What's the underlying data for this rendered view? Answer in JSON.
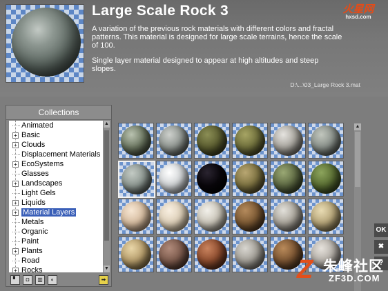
{
  "material": {
    "title": "Large Scale Rock 3",
    "description_1": "A variation of the previous rock materials with different colors and fractal patterns. This material is designed for large scale terrains, hence the scale of 100.",
    "description_2": "Single layer material designed to appear at high altitudes and steep slopes.",
    "file_path": "D:\\...\\03_Large Rock 3.mat",
    "preview_icon": "rock-sphere-preview"
  },
  "watermarks": {
    "top_right_brand": "火星网",
    "top_right_domain": "hxsd.com",
    "bottom_right_logo": "Z",
    "bottom_right_cn": "朱峰社区",
    "bottom_right_en": "ZF3D.COM"
  },
  "collections": {
    "title": "Collections",
    "items": [
      {
        "label": "Animated",
        "expandable": false,
        "selected": false
      },
      {
        "label": "Basic",
        "expandable": true,
        "selected": false
      },
      {
        "label": "Clouds",
        "expandable": true,
        "selected": false
      },
      {
        "label": "Displacement Materials",
        "expandable": false,
        "selected": false
      },
      {
        "label": "EcoSystems",
        "expandable": true,
        "selected": false
      },
      {
        "label": "Glasses",
        "expandable": false,
        "selected": false
      },
      {
        "label": "Landscapes",
        "expandable": true,
        "selected": false
      },
      {
        "label": "Light Gels",
        "expandable": false,
        "selected": false
      },
      {
        "label": "Liquids",
        "expandable": true,
        "selected": false
      },
      {
        "label": "Material Layers",
        "expandable": true,
        "selected": true
      },
      {
        "label": "Metals",
        "expandable": false,
        "selected": false
      },
      {
        "label": "Organic",
        "expandable": false,
        "selected": false
      },
      {
        "label": "Paint",
        "expandable": false,
        "selected": false
      },
      {
        "label": "Plants",
        "expandable": true,
        "selected": false
      },
      {
        "label": "Road",
        "expandable": false,
        "selected": false
      },
      {
        "label": "Rocks",
        "expandable": true,
        "selected": false
      }
    ],
    "toolbar_icons": [
      "new-collection-icon",
      "lock-icon",
      "delete-icon",
      "refresh-icon",
      "go-arrow-icon"
    ],
    "expander_glyph": "+"
  },
  "swatch_grid": {
    "selected_index": 6,
    "swatches": [
      {
        "icon": "mossy-rock-sphere",
        "colors": [
          "#b9c2b0",
          "#6d7862",
          "#2c3326"
        ]
      },
      {
        "icon": "grey-rock-sphere",
        "colors": [
          "#cdd0cc",
          "#8f9590",
          "#3a3f3c"
        ]
      },
      {
        "icon": "green-moss-sphere",
        "colors": [
          "#8b8e55",
          "#5b5d30",
          "#262713"
        ]
      },
      {
        "icon": "olive-sphere",
        "colors": [
          "#a6a464",
          "#70703c",
          "#30301a"
        ]
      },
      {
        "icon": "granite-sphere",
        "colors": [
          "#e5e3df",
          "#a8a59e",
          "#54524d"
        ]
      },
      {
        "icon": "weathered-rock-sphere",
        "colors": [
          "#c1c6bd",
          "#89908a",
          "#3b403c"
        ]
      },
      {
        "icon": "large-scale-rock-sphere",
        "colors": [
          "#c3cac4",
          "#8c9690",
          "#2e3532"
        ]
      },
      {
        "icon": "white-stone-sphere",
        "colors": [
          "#ffffff",
          "#d0d3d5",
          "#7e8285"
        ]
      },
      {
        "icon": "black-sphere",
        "colors": [
          "#2a2430",
          "#0a070c",
          "#000000"
        ]
      },
      {
        "icon": "moss-sphere",
        "colors": [
          "#b8a672",
          "#7f7442",
          "#3a341c"
        ]
      },
      {
        "icon": "lichen-sphere",
        "colors": [
          "#9aa874",
          "#5f6b44",
          "#26301c"
        ]
      },
      {
        "icon": "grass-sphere",
        "colors": [
          "#8ca45c",
          "#5a6e33",
          "#233014"
        ]
      },
      {
        "icon": "sandstone-sphere",
        "colors": [
          "#f6e6d3",
          "#d6bca0",
          "#8d735a"
        ]
      },
      {
        "icon": "wavy-sand-sphere",
        "colors": [
          "#f8efe1",
          "#ddcfb8",
          "#9c8c71"
        ]
      },
      {
        "icon": "chalk-rock-sphere",
        "colors": [
          "#f2f0ea",
          "#c9c4b8",
          "#6e6a61"
        ]
      },
      {
        "icon": "brown-rock-sphere",
        "colors": [
          "#b48a5c",
          "#7d5a34",
          "#362414"
        ]
      },
      {
        "icon": "stone-sphere",
        "colors": [
          "#e2e0da",
          "#a9a49a",
          "#595550"
        ]
      },
      {
        "icon": "tan-rock-sphere",
        "colors": [
          "#e8dbb3",
          "#b6a579",
          "#5e5234"
        ]
      },
      {
        "icon": "pebble-sphere",
        "colors": [
          "#e9d6a8",
          "#b59c6b",
          "#5e4d2c"
        ]
      },
      {
        "icon": "red-rock-sphere",
        "colors": [
          "#b08a7a",
          "#7c5a4c",
          "#36241d"
        ]
      },
      {
        "icon": "rust-rock-sphere",
        "colors": [
          "#c9835e",
          "#8d4c2e",
          "#3e2012"
        ]
      },
      {
        "icon": "gravel-sphere",
        "colors": [
          "#d8d6d0",
          "#a29e96",
          "#55524d"
        ]
      },
      {
        "icon": "dark-rock-sphere",
        "colors": [
          "#b98a5a",
          "#7a5432",
          "#332213"
        ]
      },
      {
        "icon": "speckled-sphere",
        "colors": [
          "#e6e2dc",
          "#b2ada6",
          "#5d5955"
        ]
      }
    ]
  },
  "side_buttons": {
    "ok_label": "OK",
    "cancel_label": "✖",
    "help_label": "?"
  }
}
